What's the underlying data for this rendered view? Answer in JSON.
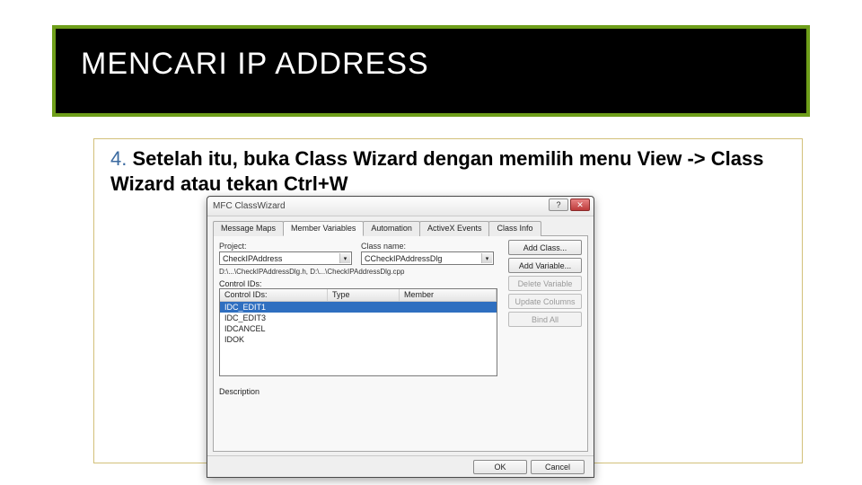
{
  "slide": {
    "title": "MENCARI IP ADDRESS",
    "step_number": "4.",
    "instruction": "Setelah itu, buka Class Wizard dengan memilih menu View -> Class Wizard atau tekan Ctrl+W"
  },
  "dialog": {
    "title": "MFC ClassWizard",
    "win": {
      "help": "?",
      "close": "✕"
    },
    "tabs": [
      "Message Maps",
      "Member Variables",
      "Automation",
      "ActiveX Events",
      "Class Info"
    ],
    "active_tab_index": 1,
    "labels": {
      "project": "Project:",
      "class_name": "Class name:",
      "control_ids": "Control IDs:",
      "type": "Type",
      "member": "Member",
      "description": "Description"
    },
    "project_value": "CheckIPAddress",
    "class_name_value": "CCheckIPAddressDlg",
    "path_line": "D:\\...\\CheckIPAddressDlg.h, D:\\...\\CheckIPAddressDlg.cpp",
    "list_items": [
      "IDC_EDIT1",
      "IDC_EDIT3",
      "IDCANCEL",
      "IDOK"
    ],
    "selected_index": 0,
    "side_buttons": [
      {
        "label": "Add Class...",
        "enabled": true
      },
      {
        "label": "Add Variable...",
        "enabled": true
      },
      {
        "label": "Delete Variable",
        "enabled": false
      },
      {
        "label": "Update Columns",
        "enabled": false
      },
      {
        "label": "Bind All",
        "enabled": false
      }
    ],
    "bottom_buttons": {
      "ok": "OK",
      "cancel": "Cancel"
    }
  }
}
